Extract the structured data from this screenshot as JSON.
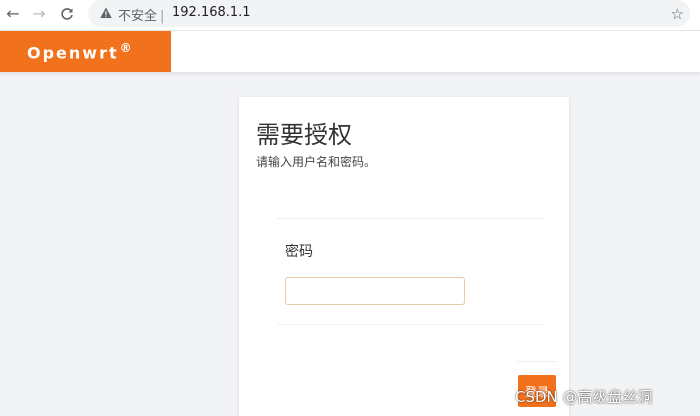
{
  "browser": {
    "security_label": "不安全",
    "divider": "|",
    "url": "192.168.1.1",
    "icons": {
      "back": "back-arrow-icon",
      "forward": "forward-arrow-icon",
      "reload": "reload-icon",
      "warning": "warning-triangle-icon",
      "bookmark": "star-icon"
    }
  },
  "header": {
    "brand": "Openwrt",
    "registered_mark": "®",
    "brand_color": "#f2711c"
  },
  "login": {
    "title": "需要授权",
    "description": "请输入用户名和密码。",
    "password_label": "密码",
    "password_value": "",
    "login_button": "登录"
  },
  "watermark": "CSDN @高级盘丝洞"
}
